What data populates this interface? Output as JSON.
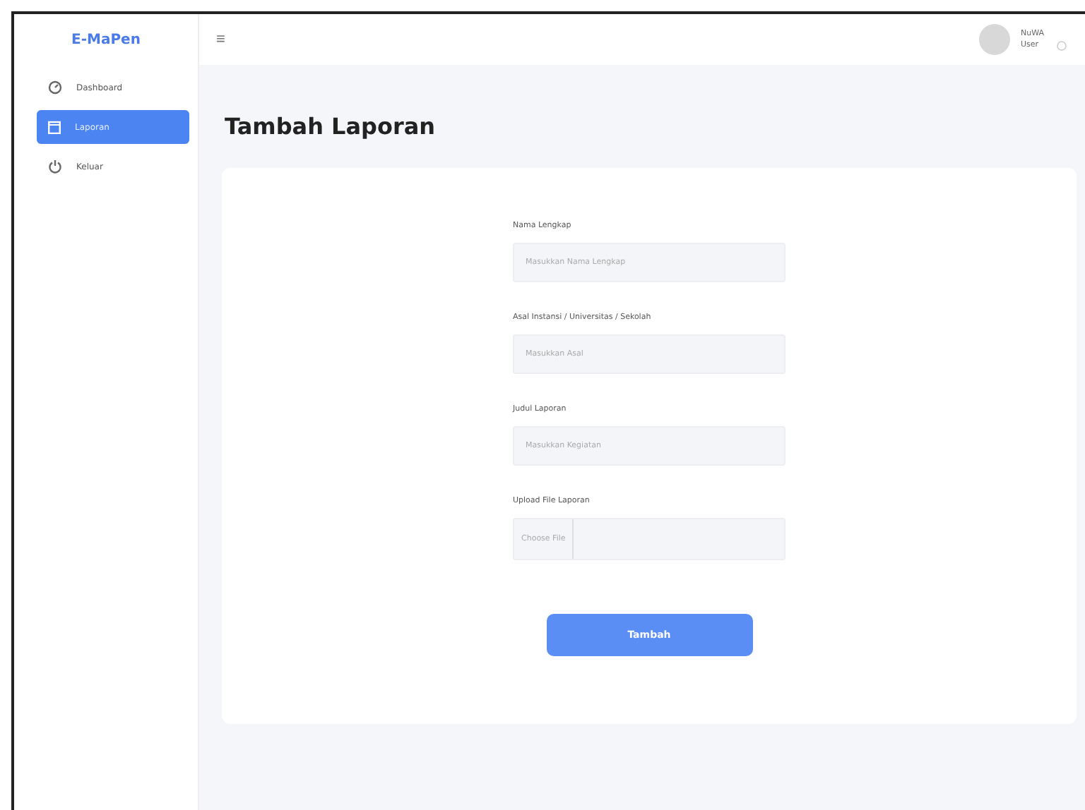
{
  "sidebar": {
    "brand": "E-MaPen",
    "items": [
      {
        "label": "Dashboard",
        "kind": "dashboard",
        "selected": false
      },
      {
        "label": "Laporan",
        "kind": "report",
        "selected": true
      },
      {
        "label": "Keluar",
        "kind": "logout",
        "selected": false
      }
    ]
  },
  "topbar": {
    "menu_icon": "≡",
    "user": {
      "name": "NuWA",
      "role": "User"
    }
  },
  "page": {
    "title": "Tambah Laporan"
  },
  "form": {
    "fields": [
      {
        "label": "Nama Lengkap",
        "kind": "text",
        "placeholder": "Masukkan Nama Lengkap"
      },
      {
        "label": "Asal Instansi / Universitas / Sekolah",
        "kind": "text",
        "placeholder": "Masukkan Asal"
      },
      {
        "label": "Judul Laporan",
        "kind": "text",
        "placeholder": "Masukkan Kegiatan"
      },
      {
        "label": "Upload File Laporan",
        "kind": "file",
        "button": "Choose File"
      }
    ],
    "submit": "Tambah"
  }
}
